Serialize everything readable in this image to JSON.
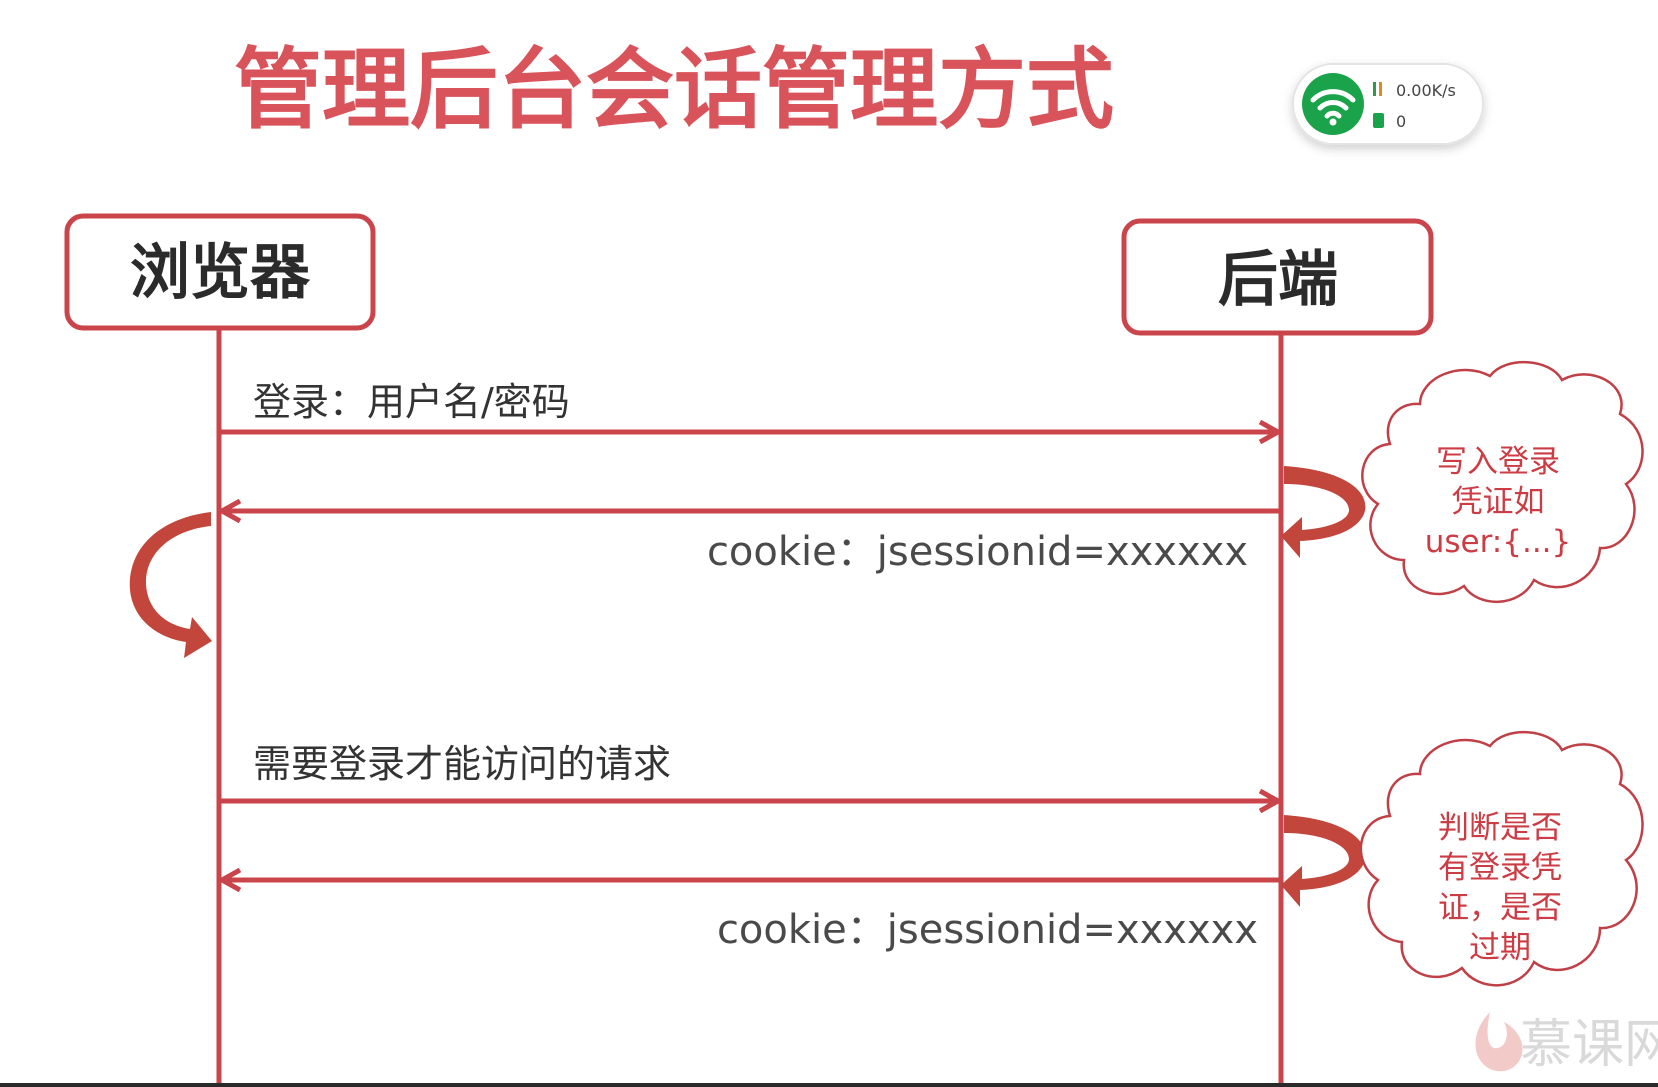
{
  "title": "管理后台会话管理方式",
  "actors": {
    "left": "浏览器",
    "right": "后端"
  },
  "messages": {
    "login": "登录：用户名/密码",
    "login_response": "cookie：jsessionid=xxxxxx",
    "request": "需要登录才能访问的请求",
    "request_response": "cookie：jsessionid=xxxxxx"
  },
  "notes": {
    "write_credential": [
      "写入登录",
      "凭证如",
      "user:{...}"
    ],
    "check_credential": [
      "判断是否",
      "有登录凭",
      "证，是否",
      "过期"
    ]
  },
  "network_widget": {
    "speed": "0.00K/s",
    "count": "0",
    "icon": "wifi-icon",
    "status_color": "#1aa34a"
  },
  "watermark": {
    "text": "慕课网"
  },
  "colors": {
    "accent": "#c9444b",
    "title": "#d9535b",
    "note_text": "#cc3c44"
  }
}
